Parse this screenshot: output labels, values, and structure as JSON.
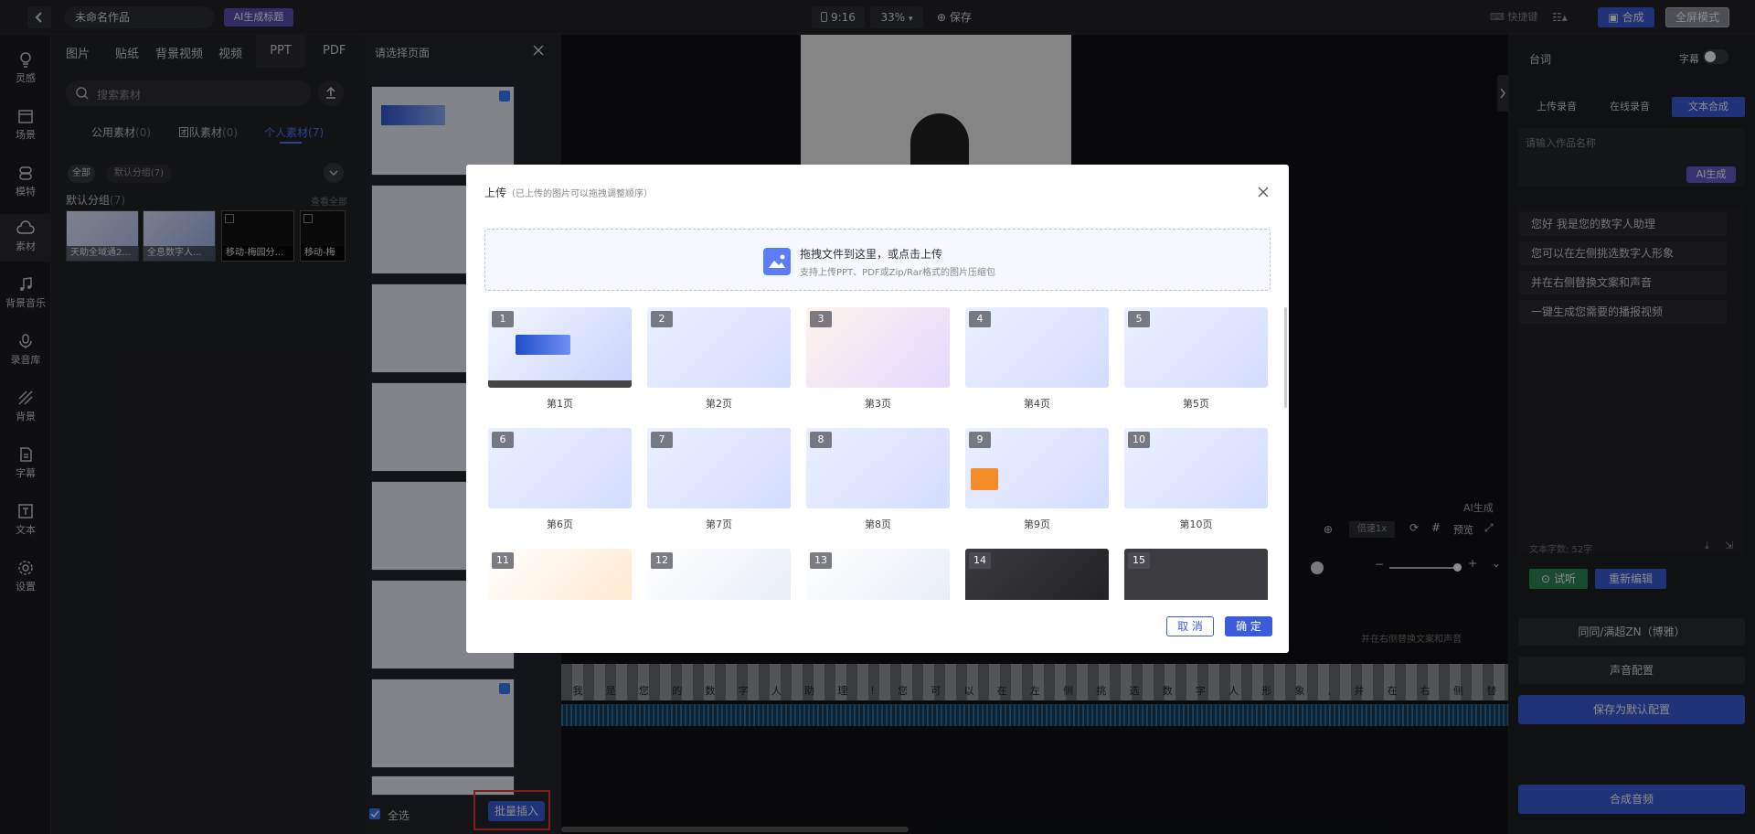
{
  "topbar": {
    "back_label": "<",
    "project_name": "未命名作品",
    "ai_title_btn": "AI生成标题",
    "ratio": "9:16",
    "zoom": "33%",
    "save": "保存",
    "shortcuts": "快捷键",
    "compose": "合成",
    "fullscreen": "全屏模式"
  },
  "sidebar": {
    "items": [
      {
        "label": "灵感",
        "icon": "bulb-icon"
      },
      {
        "label": "场景",
        "icon": "scene-icon"
      },
      {
        "label": "模特",
        "icon": "model-icon"
      },
      {
        "label": "素材",
        "icon": "cloud-icon"
      },
      {
        "label": "背景音乐",
        "icon": "music-icon"
      },
      {
        "label": "录音库",
        "icon": "mic-icon"
      },
      {
        "label": "背景",
        "icon": "background-icon"
      },
      {
        "label": "字幕",
        "icon": "subtitle-icon"
      },
      {
        "label": "文本",
        "icon": "text-icon"
      },
      {
        "label": "设置",
        "icon": "gear-icon"
      }
    ]
  },
  "asset_panel": {
    "tabs": [
      "图片",
      "贴纸",
      "背景视频",
      "视频",
      "PPT",
      "PDF"
    ],
    "active_tab": "PPT",
    "search_placeholder": "搜索素材",
    "subtabs": [
      {
        "label": "公用素材",
        "count": "(0)"
      },
      {
        "label": "团队素材",
        "count": "(0)"
      },
      {
        "label": "个人素材",
        "count": "(7)"
      }
    ],
    "chip_all": "全部",
    "chip_group": "默认分组(7)",
    "group_title": "默认分组",
    "group_count": "(7)",
    "view_all": "查看全部",
    "items": [
      "天助全域通2...",
      "全息数字人...",
      "移动-梅园分...",
      "移动-梅"
    ]
  },
  "page_select": {
    "title": "请选择页面",
    "select_all": "全选",
    "batch_insert": "批量插入"
  },
  "workspace": {
    "ai_gen": "AI生成",
    "speed": "倍速1x",
    "preview": "预览",
    "hint": "并在右侧替换文案和声音",
    "subtitle_chars": [
      "我",
      "是",
      "您",
      "的",
      "数",
      "字",
      "人",
      "助",
      "理",
      "!",
      "您",
      "可",
      "以",
      "在",
      "左",
      "侧",
      "挑",
      "选",
      "数",
      "字",
      "人",
      "形",
      "象",
      ",",
      "并",
      "在",
      "右",
      "侧",
      "替"
    ]
  },
  "right_panel": {
    "title": "台词",
    "subtitle_toggle": "字幕",
    "tabs": [
      "上传录音",
      "在线录音",
      "文本合成"
    ],
    "name_placeholder": "请输入作品名称",
    "ai_btn": "AI生成",
    "lines": [
      "您好 我是您的数字人助理",
      "您可以在左侧挑选数字人形象",
      "并在右侧替换文案和声音",
      "一键生成您需要的播报视频"
    ],
    "char_count": "文本字数: 52字",
    "listen": "试听",
    "reedit": "重新编辑",
    "voice": "同同/满超ZN（博雅）",
    "voice_config": "声音配置",
    "save_default": "保存为默认配置",
    "compose_audio": "合成音频"
  },
  "modal": {
    "title": "上传",
    "subtitle": "（已上传的图片可以拖拽调整顺序）",
    "drop_main": "拖拽文件到这里，或点击上传",
    "drop_sub": "支持上传PPT、PDF或Zip/Rar格式的图片压缩包",
    "slides": [
      {
        "num": "1",
        "label": "第1页"
      },
      {
        "num": "2",
        "label": "第2页"
      },
      {
        "num": "3",
        "label": "第3页"
      },
      {
        "num": "4",
        "label": "第4页"
      },
      {
        "num": "5",
        "label": "第5页"
      },
      {
        "num": "6",
        "label": "第6页"
      },
      {
        "num": "7",
        "label": "第7页"
      },
      {
        "num": "8",
        "label": "第8页"
      },
      {
        "num": "9",
        "label": "第9页"
      },
      {
        "num": "10",
        "label": "第10页"
      },
      {
        "num": "11",
        "label": ""
      },
      {
        "num": "12",
        "label": ""
      },
      {
        "num": "13",
        "label": ""
      },
      {
        "num": "14",
        "label": ""
      },
      {
        "num": "15",
        "label": ""
      }
    ],
    "cancel": "取 消",
    "confirm": "确 定"
  },
  "colors": {
    "accent": "#3b5bdb",
    "ai": "#6a5acd",
    "highlight_box": "#e53935"
  }
}
